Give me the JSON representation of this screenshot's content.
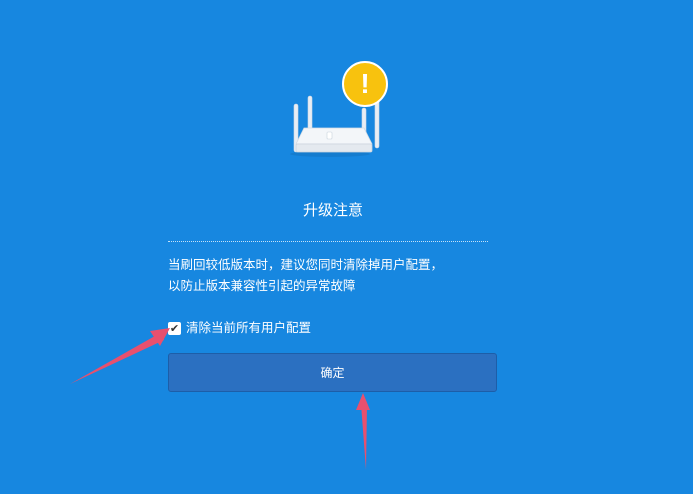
{
  "icons": {
    "router": "router-icon",
    "warning": "exclamation-warning-icon",
    "check": "checkmark-icon"
  },
  "colors": {
    "background": "#1787e0",
    "button": "#2b70c1",
    "warning_badge": "#f8c20e",
    "annotation_arrow": "#e8506e"
  },
  "warning": {
    "symbol": "!"
  },
  "dialog": {
    "title": "升级注意",
    "notice_lines": [
      "当刷回较低版本时，建议您同时清除掉用户配置，",
      "以防止版本兼容性引起的异常故障"
    ],
    "checkbox": {
      "checked": true,
      "label": "清除当前所有用户配置"
    },
    "confirm_label": "确定"
  }
}
